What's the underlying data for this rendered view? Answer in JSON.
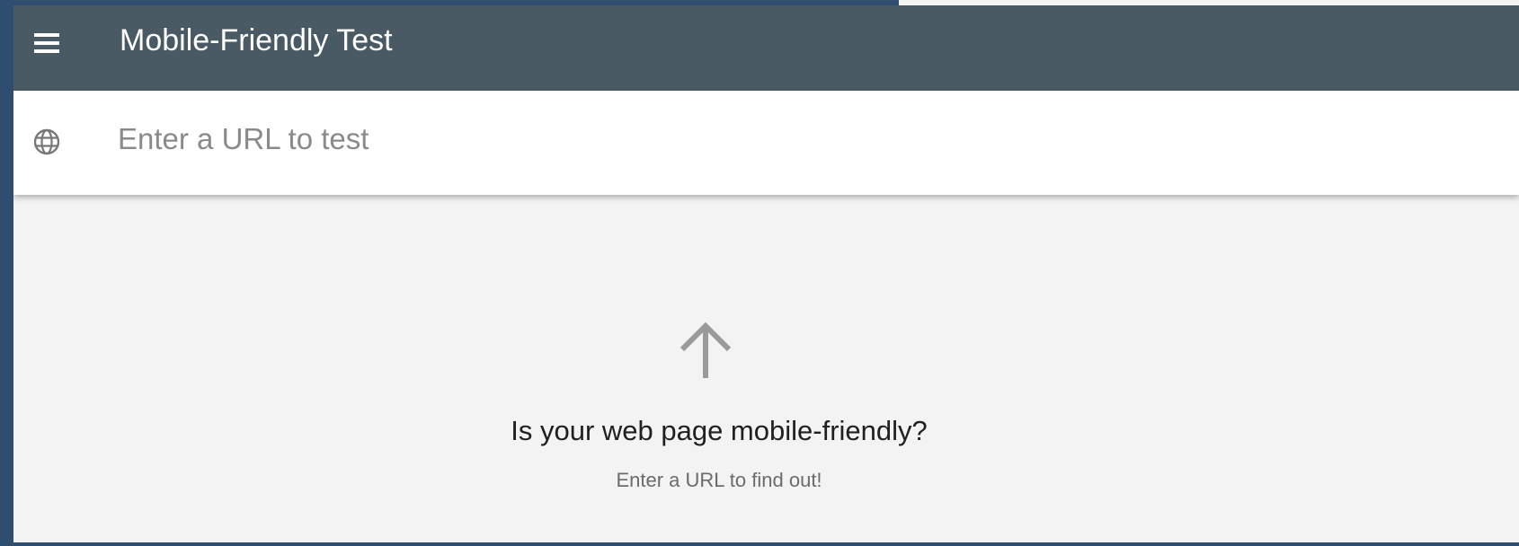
{
  "app": {
    "title": "Mobile-Friendly Test",
    "bar_color": "#4a5a64"
  },
  "icons": {
    "menu": "hamburger-menu-icon",
    "globe": "globe-icon",
    "arrow": "arrow-up-icon"
  },
  "search": {
    "placeholder": "Enter a URL to test",
    "value": ""
  },
  "empty_state": {
    "headline": "Is your web page mobile-friendly?",
    "subtext": "Enter a URL to find out!"
  }
}
